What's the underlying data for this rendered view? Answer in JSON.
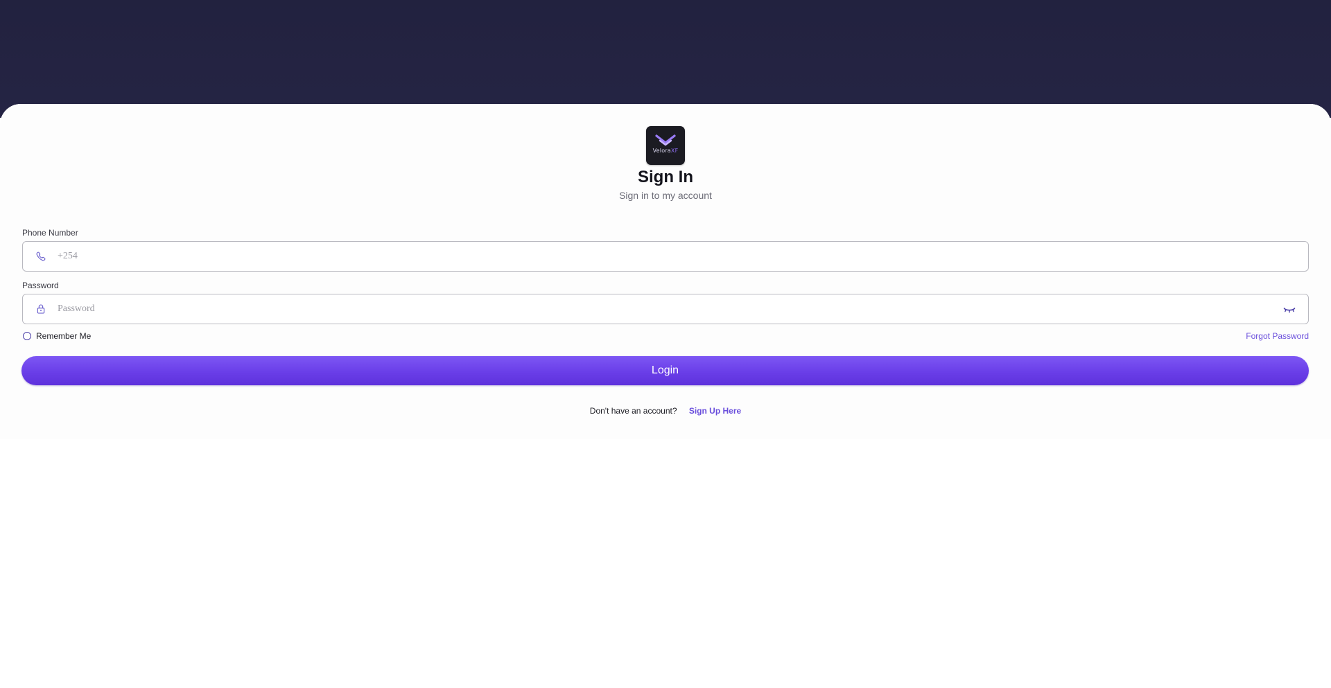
{
  "brand": {
    "logo_text": "Velora",
    "logo_text_accent": "XF",
    "accent_color": "#6a3ee8",
    "header_color": "#22223f"
  },
  "header": {
    "title": "Sign In",
    "subtitle": "Sign in to my account"
  },
  "form": {
    "phone": {
      "label": "Phone Number",
      "placeholder": "+254",
      "value": "",
      "icon": "phone-icon"
    },
    "password": {
      "label": "Password",
      "placeholder": "Password",
      "value": "",
      "icon": "lock-icon",
      "toggle_icon": "eye-closed-icon"
    },
    "remember_label": "Remember Me",
    "remember_checked": false,
    "forgot_label": "Forgot Password",
    "login_label": "Login"
  },
  "footer": {
    "prompt": "Don't have an account?",
    "signup_label": "Sign Up Here"
  }
}
